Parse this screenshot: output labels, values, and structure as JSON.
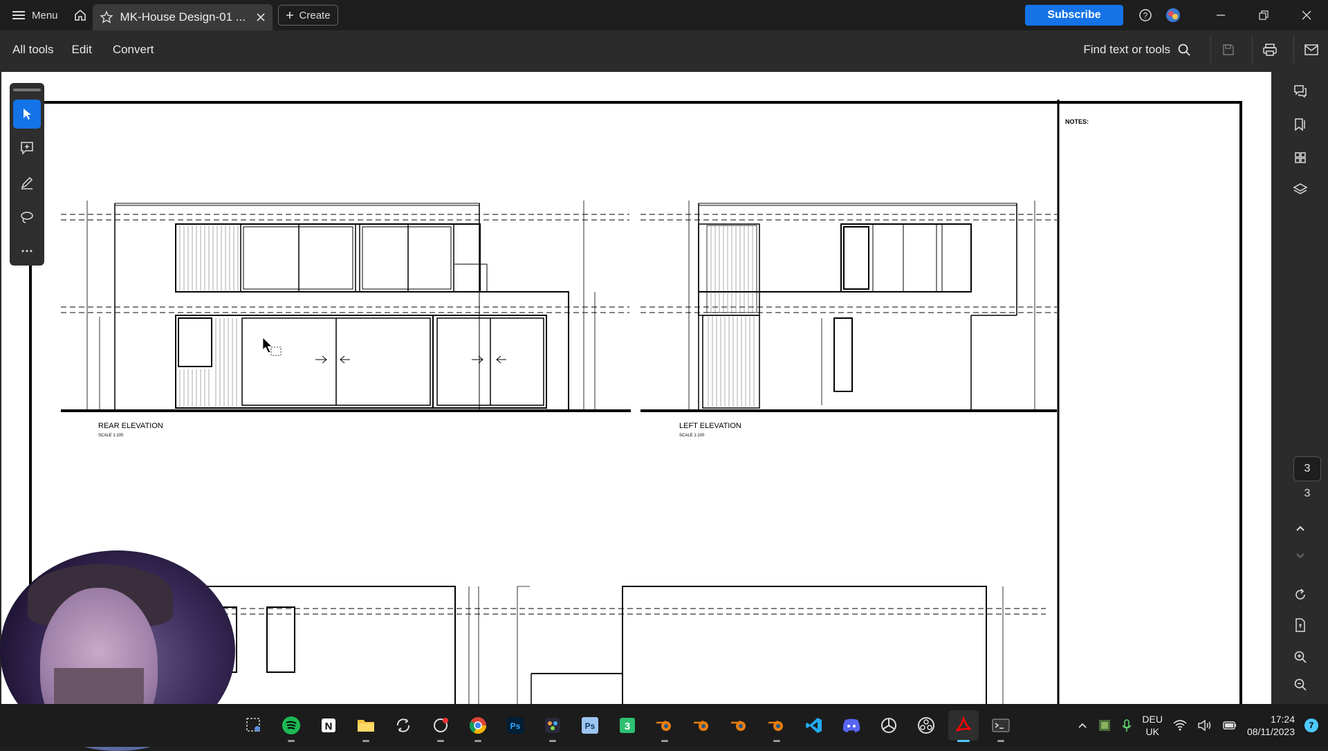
{
  "titlebar": {
    "menu_label": "Menu",
    "tab_title": "MK-House Design-01 ...",
    "create_label": "Create",
    "subscribe_label": "Subscribe"
  },
  "menubar": {
    "items": [
      "All tools",
      "Edit",
      "Convert"
    ],
    "find_label": "Find text or tools"
  },
  "drawing": {
    "notes_label": "NOTES:",
    "rear_title": "REAR ELEVATION",
    "rear_scale": "SCALE 1:100",
    "left_title": "LEFT ELEVATION",
    "left_scale": "SCALE 1:100"
  },
  "page_nav": {
    "current": "3",
    "total": "3"
  },
  "taskbar": {
    "lang_line1": "DEU",
    "lang_line2": "UK",
    "time": "17:24",
    "date": "08/11/2023",
    "notifications": "7"
  },
  "colors": {
    "accent": "#1473e6",
    "titlebar_bg": "#1e1e1e",
    "toolbar_bg": "#2b2b2b",
    "taskbar_bg": "#1c1c1c"
  }
}
